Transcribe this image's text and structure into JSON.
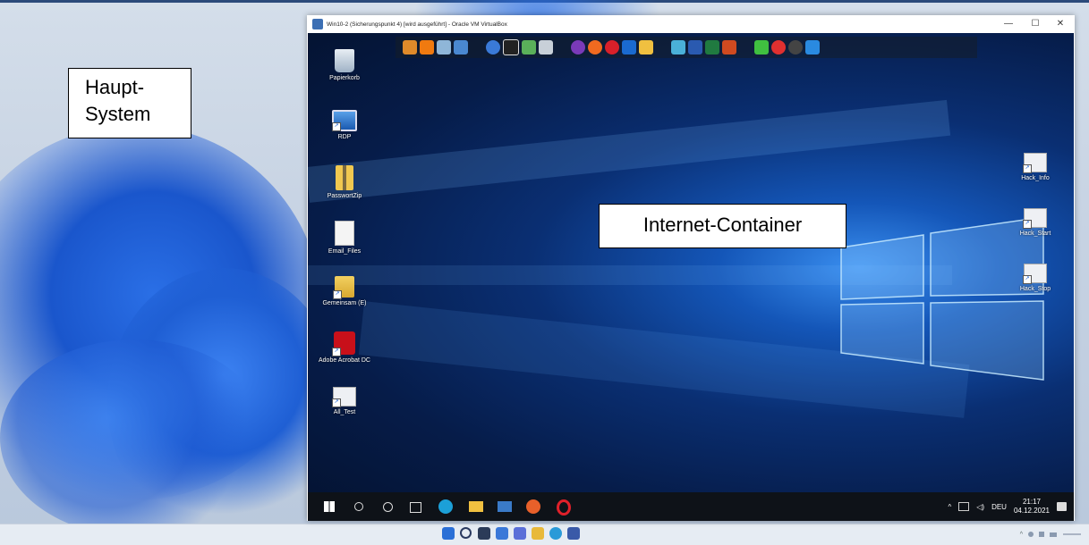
{
  "annotations": {
    "host_label": "Haupt- System",
    "container_label": "Internet-Container"
  },
  "vbox": {
    "title": "Win10-2 (Sicherungspunkt 4) [wird ausgeführt] - Oracle VM VirtualBox",
    "minimize_glyph": "—",
    "maximize_glyph": "☐",
    "close_glyph": "✕"
  },
  "guest_desktop": {
    "icons_left": [
      {
        "label": "Papierkorb",
        "icon": "recycle-bin-icon"
      },
      {
        "label": "RDP",
        "icon": "remote-desktop-icon"
      },
      {
        "label": "PasswortZip",
        "icon": "zip-folder-icon"
      },
      {
        "label": "Email_Files",
        "icon": "document-icon"
      },
      {
        "label": "Gemeinsam (E)",
        "icon": "shared-drive-icon"
      },
      {
        "label": "Adobe Acrobat DC",
        "icon": "acrobat-icon"
      },
      {
        "label": "All_Test",
        "icon": "script-icon"
      }
    ],
    "icons_right": [
      {
        "label": "Hack_Info",
        "icon": "script-icon"
      },
      {
        "label": "Hack_Start",
        "icon": "script-icon"
      },
      {
        "label": "Hack_Stop",
        "icon": "script-icon"
      }
    ]
  },
  "guest_taskbar": {
    "language": "DEU",
    "time": "21:17",
    "date": "04.12.2021"
  },
  "colors": {
    "guest_bg": "#0a2f73",
    "host_bg": "#c9d6e6",
    "taskbar_dark": "#0e1218"
  }
}
